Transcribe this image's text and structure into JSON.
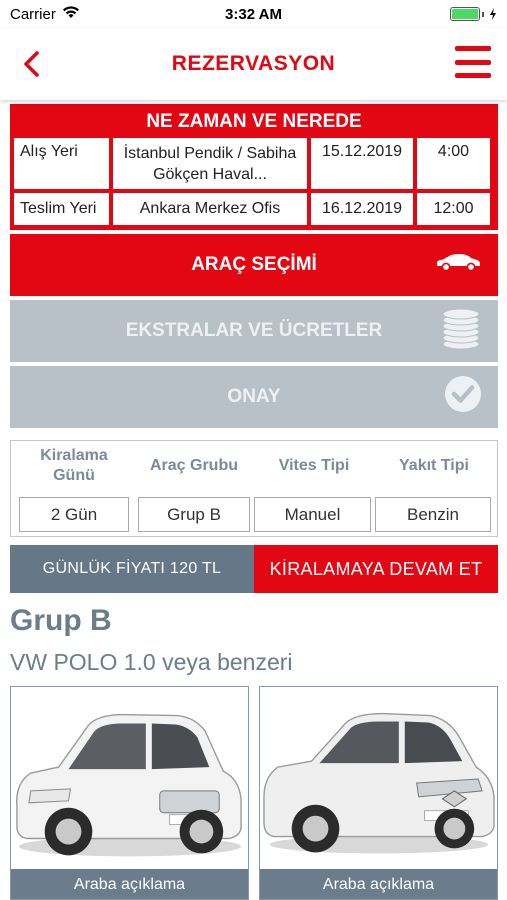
{
  "status": {
    "carrier": "Carrier",
    "time": "3:32 AM"
  },
  "nav": {
    "title": "REZERVASYON"
  },
  "where_when": {
    "title": "NE ZAMAN VE NEREDE",
    "pickup": {
      "label": "Alış Yeri",
      "location": "İstanbul Pendik / Sabiha Gökçen Haval...",
      "date": "15.12.2019",
      "time": "4:00"
    },
    "return": {
      "label": "Teslim Yeri",
      "location": "Ankara Merkez Ofis",
      "date": "16.12.2019",
      "time": "12:00"
    }
  },
  "steps": {
    "vehicle": "ARAÇ SEÇİMİ",
    "extras": "EKSTRALAR VE ÜCRETLER",
    "confirm": "ONAY"
  },
  "filters": {
    "days": {
      "label": "Kiralama Günü",
      "value": "2 Gün"
    },
    "group": {
      "label": "Araç Grubu",
      "value": "Grup B"
    },
    "gear": {
      "label": "Vites Tipi",
      "value": "Manuel"
    },
    "fuel": {
      "label": "Yakıt Tipi",
      "value": "Benzin"
    }
  },
  "price": {
    "daily": "GÜNLÜK FİYATI 120 TL",
    "continue": "KİRALAMAYA DEVAM ET"
  },
  "group": {
    "title": "Grup B",
    "subtitle": "VW POLO 1.0 veya benzeri",
    "cars": [
      {
        "caption": "Araba açıklama"
      },
      {
        "caption": "Araba açıklama"
      }
    ]
  },
  "colors": {
    "brand_red": "#e30613",
    "slate": "#667787",
    "disabled": "#b8c0c8"
  }
}
